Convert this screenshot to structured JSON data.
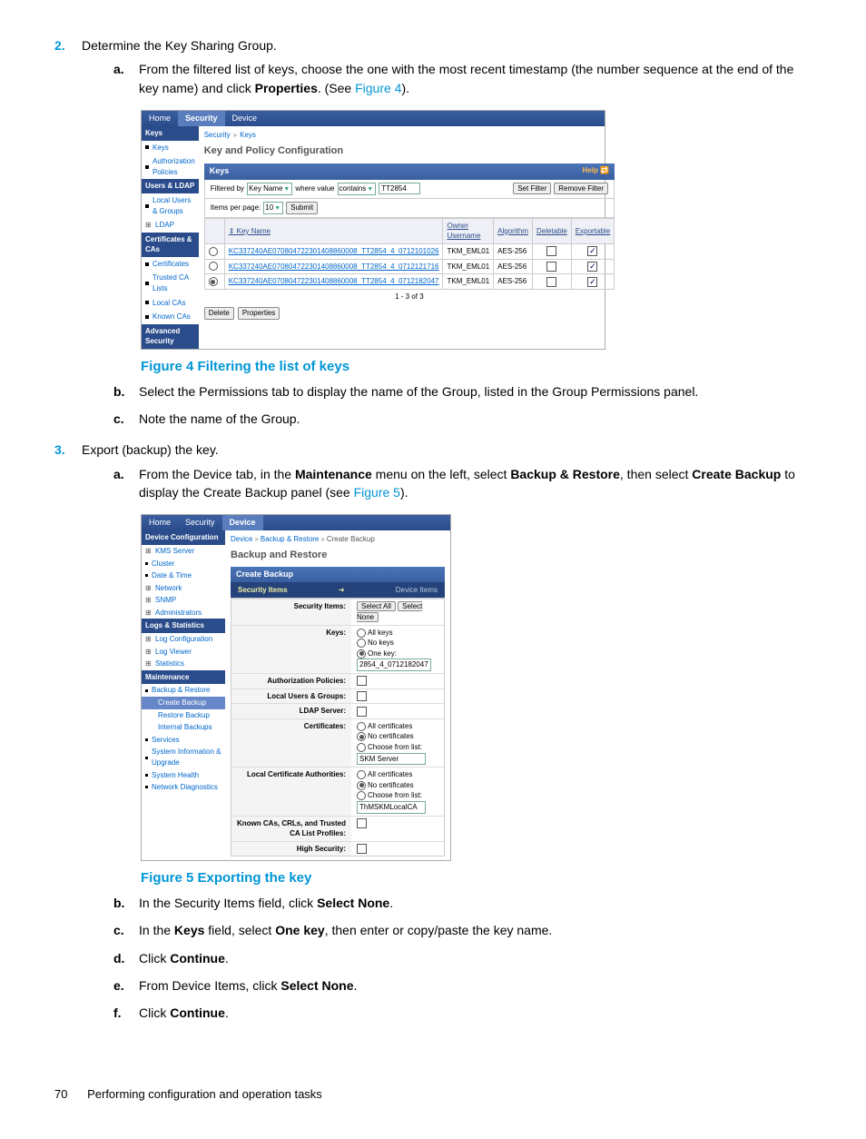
{
  "steps": {
    "s2": {
      "num": "2.",
      "text": "Determine the Key Sharing Group."
    },
    "s2a": {
      "num": "a.",
      "text_pre": "From the filtered list of keys, choose the one with the most recent timestamp (the number sequence at the end of the key name) and click ",
      "bold": "Properties",
      "text_mid": ". (See ",
      "link": "Figure 4",
      "text_post": ")."
    },
    "s2b": {
      "num": "b.",
      "text": "Select the Permissions tab to display the name of the Group, listed in the Group Permissions panel."
    },
    "s2c": {
      "num": "c.",
      "text": "Note the name of the Group."
    },
    "s3": {
      "num": "3.",
      "text": "Export (backup) the key."
    },
    "s3a": {
      "num": "a.",
      "t1": "From the Device tab, in the ",
      "b1": "Maintenance",
      "t2": " menu on the left, select ",
      "b2": "Backup & Restore",
      "t3": ", then select ",
      "b3": "Create Backup",
      "t4": " to display the Create Backup panel (see ",
      "link": "Figure 5",
      "t5": ")."
    },
    "s3b": {
      "num": "b.",
      "t1": "In the Security Items field, click ",
      "b1": "Select None",
      "t2": "."
    },
    "s3c": {
      "num": "c.",
      "t1": "In the ",
      "b1": "Keys",
      "t2": " field, select ",
      "b2": "One key",
      "t3": ", then enter or copy/paste the key name."
    },
    "s3d": {
      "num": "d.",
      "t1": "Click ",
      "b1": "Continue",
      "t2": "."
    },
    "s3e": {
      "num": "e.",
      "t1": "From Device Items, click ",
      "b1": "Select None",
      "t2": "."
    },
    "s3f": {
      "num": "f.",
      "t1": "Click ",
      "b1": "Continue",
      "t2": "."
    }
  },
  "figs": {
    "f4": "Figure 4 Filtering the list of keys",
    "f5": "Figure 5 Exporting the key"
  },
  "shot1": {
    "tabs": {
      "home": "Home",
      "security": "Security",
      "device": "Device"
    },
    "side": {
      "h1": "Keys",
      "keys": "Keys",
      "authpol": "Authorization Policies",
      "h2": "Users & LDAP",
      "lug": "Local Users & Groups",
      "ldap": "LDAP",
      "h3": "Certificates & CAs",
      "certs": "Certificates",
      "tca": "Trusted CA Lists",
      "lca": "Local CAs",
      "kca": "Known CAs",
      "h4": "Advanced Security"
    },
    "crumbs": {
      "c1": "Security",
      "c2": "Keys"
    },
    "title": "Key and Policy Configuration",
    "panel": "Keys",
    "help": "Help 🔁",
    "filter": {
      "lbl": "Filtered by",
      "field": "Key Name",
      "where": "where value",
      "op": "contains",
      "val": "TT2854",
      "set": "Set Filter",
      "remove": "Remove Filter"
    },
    "perpage": {
      "lbl": "Items per page:",
      "n": "10",
      "submit": "Submit"
    },
    "cols": {
      "kn": "Key Name",
      "ou": "Owner Username",
      "alg": "Algorithm",
      "del": "Deletable",
      "exp": "Exportable"
    },
    "rows": [
      {
        "k": "KC337240AE070804722301408860008_TT2854_4_0712101026",
        "o": "TKM_EML01",
        "a": "AES-256"
      },
      {
        "k": "KC337240AE070804722301408860008_TT2854_4_0712121716",
        "o": "TKM_EML01",
        "a": "AES-256"
      },
      {
        "k": "KC337240AE070804722301408860008_TT2854_4_0712182047",
        "o": "TKM_EML01",
        "a": "AES-256"
      }
    ],
    "pager": "1 - 3 of 3",
    "btn_del": "Delete",
    "btn_prop": "Properties"
  },
  "shot2": {
    "tabs": {
      "home": "Home",
      "security": "Security",
      "device": "Device"
    },
    "side": {
      "h1": "Device Configuration",
      "kms": "KMS Server",
      "cluster": "Cluster",
      "date": "Date & Time",
      "net": "Network",
      "snmp": "SNMP",
      "admin": "Administrators",
      "h2": "Logs & Statistics",
      "logconf": "Log Configuration",
      "logview": "Log Viewer",
      "stats": "Statistics",
      "h3": "Maintenance",
      "br": "Backup & Restore",
      "cb": "Create Backup",
      "rb": "Restore Backup",
      "ib": "Internal Backups",
      "serv": "Services",
      "sys": "System Information & Upgrade",
      "sh": "System Health",
      "nd": "Network Diagnostics"
    },
    "crumbs": {
      "c1": "Device",
      "c2": "Backup & Restore",
      "c3": "Create Backup"
    },
    "title": "Backup and Restore",
    "panel": "Create Backup",
    "tabrow": {
      "t1": "Security Items",
      "arr": "➔",
      "t2": "Device Items"
    },
    "form": {
      "secitems": "Security Items:",
      "selall": "Select All",
      "selnone": "Select None",
      "keys": "Keys:",
      "allkeys": "All keys",
      "nokeys": "No keys",
      "onekey": "One key:",
      "keyval": "2854_4_0712182047",
      "authpol": "Authorization Policies:",
      "lug": "Local Users & Groups:",
      "ldap": "LDAP Server:",
      "certs": "Certificates:",
      "allc": "All certificates",
      "noc": "No certificates",
      "cfl": "Choose from list:",
      "cval": "SKM Server",
      "lca": "Local Certificate Authorities:",
      "lcaval": "ThMSKMLocalCA",
      "known": "Known CAs, CRLs, and Trusted CA List Profiles:",
      "hs": "High Security:"
    }
  },
  "footer": {
    "page": "70",
    "title": "Performing configuration and operation tasks"
  }
}
